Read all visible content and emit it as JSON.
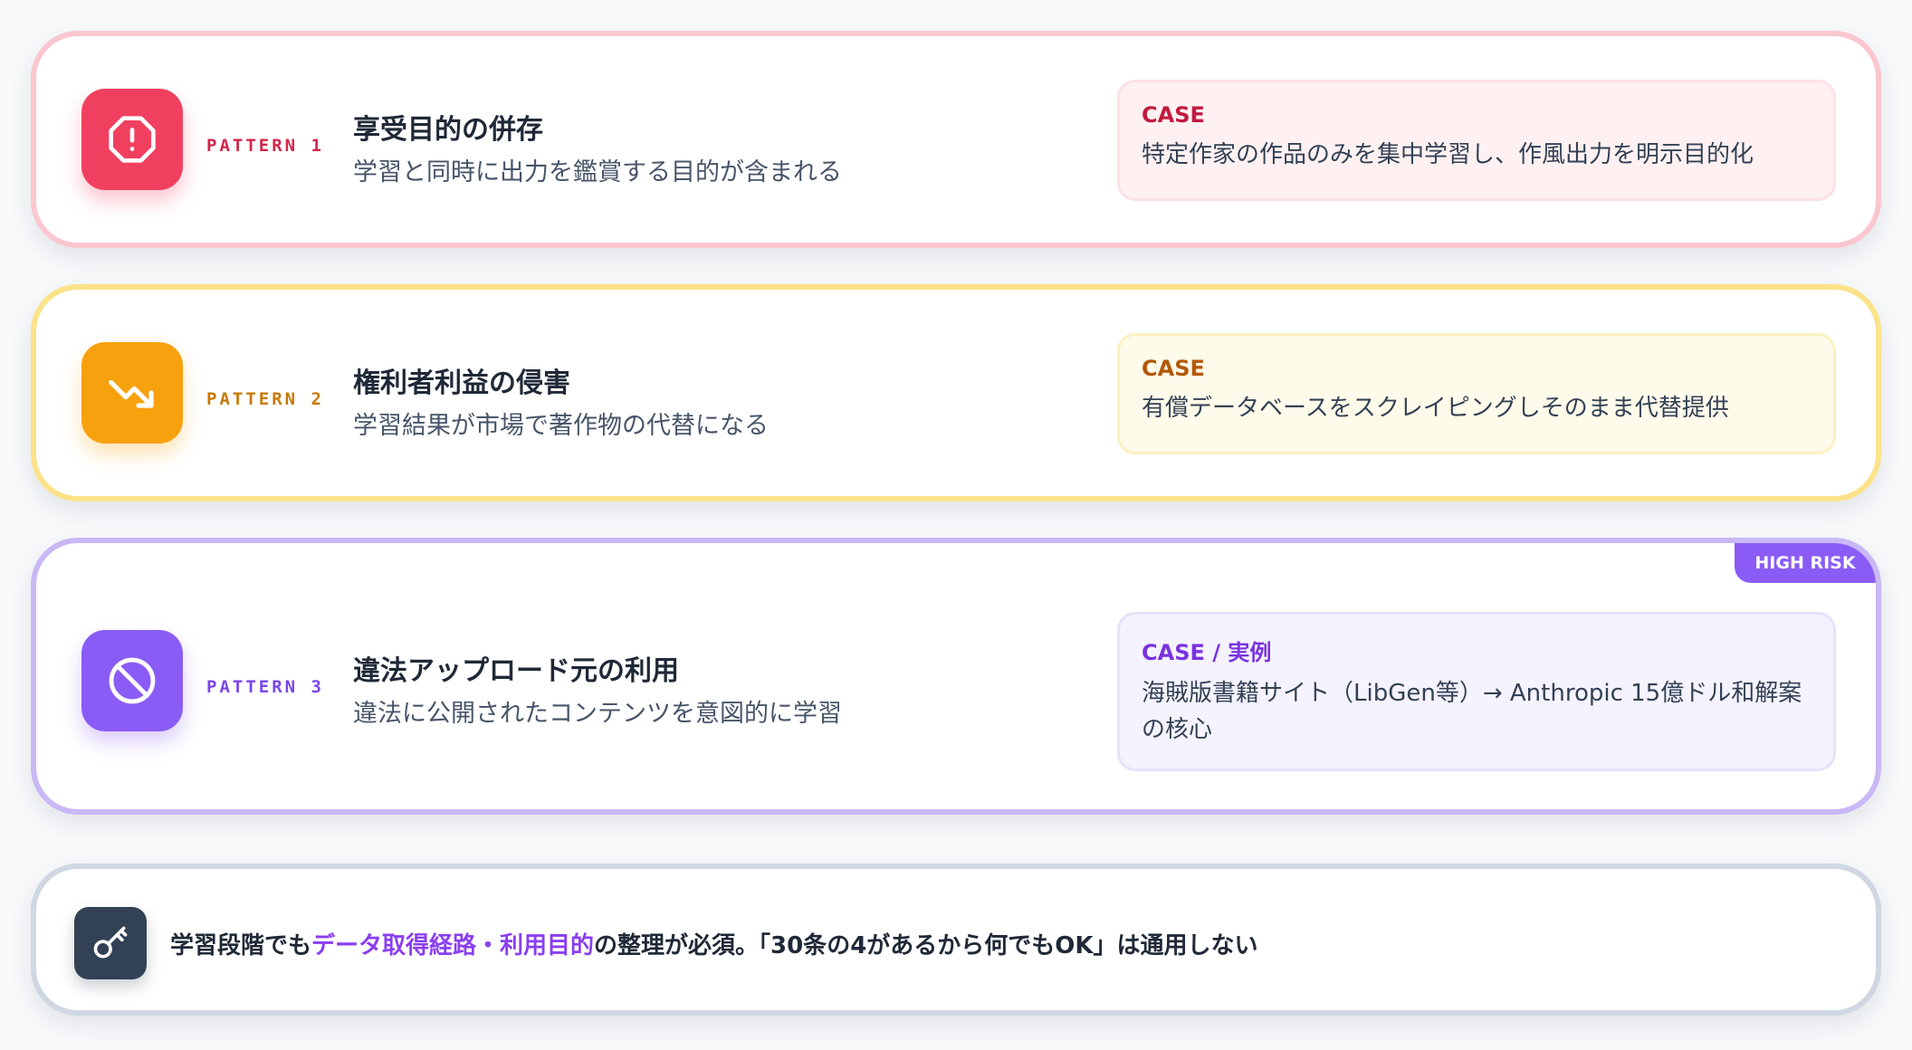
{
  "patterns": [
    {
      "label": "PATTERN 1",
      "title": "享受目的の併存",
      "subtitle": "学習と同時に出力を鑑賞する目的が含まれる",
      "case_label": "CASE",
      "case_text": "特定作家の作品のみを集中学習し、作風出力を明示目的化",
      "icon": "alert-octagon-icon",
      "color": "#f1405f"
    },
    {
      "label": "PATTERN 2",
      "title": "権利者利益の侵害",
      "subtitle": "学習結果が市場で著作物の代替になる",
      "case_label": "CASE",
      "case_text": "有償データベースをスクレイピングしそのまま代替提供",
      "icon": "trending-down-icon",
      "color": "#f7a10e"
    },
    {
      "label": "PATTERN 3",
      "title": "違法アップロード元の利用",
      "subtitle": "違法に公開されたコンテンツを意図的に学習",
      "case_label": "CASE / 実例",
      "case_text": "海賊版書籍サイト（LibGen等）→ Anthropic 15億ドル和解案の核心",
      "icon": "ban-icon",
      "color": "#8a5cf5",
      "badge": "HIGH RISK"
    }
  ],
  "note": {
    "prefix": "学習段階でも",
    "highlight": "データ取得経路・利用目的",
    "suffix": "の整理が必須。「30条の4があるから何でもOK」は通用しない",
    "icon": "key-icon",
    "highlight_color": "#8a3ff0"
  }
}
